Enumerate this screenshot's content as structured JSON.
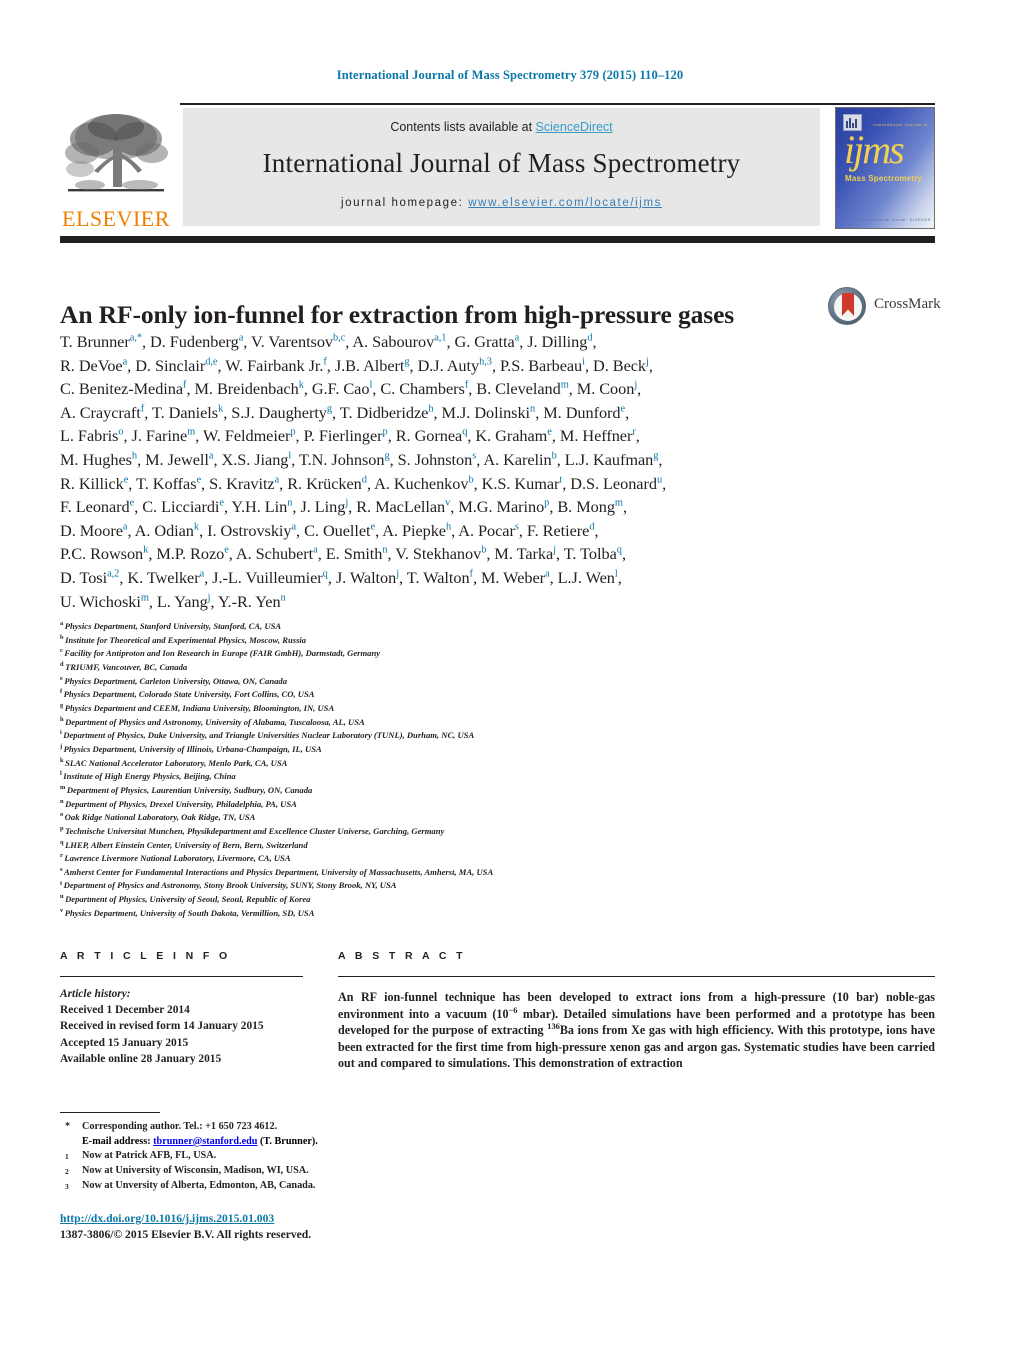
{
  "running_head": "International Journal of Mass Spectrometry 379 (2015) 110–120",
  "masthead": {
    "contents_prefix": "Contents lists available at ",
    "sciencedirect": "ScienceDirect",
    "journal_title": "International Journal of Mass Spectrometry",
    "homepage_prefix": "journal homepage: ",
    "homepage_url": "www.elsevier.com/locate/ijms",
    "publisher_logo_text": "ELSEVIER",
    "cover": {
      "logo_text": "ijms",
      "subtitle": "Mass Spectrometry",
      "top_text": "International Journal of",
      "foot_text": "An International Journal  ·  ELSEVIER"
    },
    "accent_link_color": "#3a9bc8",
    "elsevier_orange": "#ee8000",
    "band_color": "#e7e7e7",
    "rule_color": "#231f20"
  },
  "crossmark": {
    "label": "CrossMark",
    "ribbon_color": "#cf3a2a"
  },
  "title": "An RF-only ion-funnel for extraction from high-pressure gases",
  "authors_lines": [
    [
      {
        "name": "T. Brunner",
        "sup": "a,*"
      },
      {
        "name": ", D. Fudenberg",
        "sup": "a"
      },
      {
        "name": ", V. Varentsov",
        "sup": "b,c"
      },
      {
        "name": ", A. Sabourov",
        "sup": "a,1"
      },
      {
        "name": ", G. Gratta",
        "sup": "a"
      },
      {
        "name": ", J. Dilling",
        "sup": "d"
      },
      {
        "name": ",",
        "sup": ""
      }
    ],
    [
      {
        "name": "R. DeVoe",
        "sup": "a"
      },
      {
        "name": ", D. Sinclair",
        "sup": "d,e"
      },
      {
        "name": ", W. Fairbank Jr.",
        "sup": "f"
      },
      {
        "name": ", J.B. Albert",
        "sup": "g"
      },
      {
        "name": ", D.J. Auty",
        "sup": "h,3"
      },
      {
        "name": ", P.S. Barbeau",
        "sup": "i"
      },
      {
        "name": ", D. Beck",
        "sup": "j"
      },
      {
        "name": ",",
        "sup": ""
      }
    ],
    [
      {
        "name": "C. Benitez-Medina",
        "sup": "f"
      },
      {
        "name": ", M. Breidenbach",
        "sup": "k"
      },
      {
        "name": ", G.F. Cao",
        "sup": "l"
      },
      {
        "name": ", C. Chambers",
        "sup": "f"
      },
      {
        "name": ", B. Cleveland",
        "sup": "m"
      },
      {
        "name": ", M. Coon",
        "sup": "j"
      },
      {
        "name": ",",
        "sup": ""
      }
    ],
    [
      {
        "name": "A. Craycraft",
        "sup": "f"
      },
      {
        "name": ", T. Daniels",
        "sup": "k"
      },
      {
        "name": ", S.J. Daugherty",
        "sup": "g"
      },
      {
        "name": ", T. Didberidze",
        "sup": "h"
      },
      {
        "name": ", M.J. Dolinski",
        "sup": "n"
      },
      {
        "name": ", M. Dunford",
        "sup": "e"
      },
      {
        "name": ",",
        "sup": ""
      }
    ],
    [
      {
        "name": "L. Fabris",
        "sup": "o"
      },
      {
        "name": ", J. Farine",
        "sup": "m"
      },
      {
        "name": ", W. Feldmeier",
        "sup": "p"
      },
      {
        "name": ", P. Fierlinger",
        "sup": "p"
      },
      {
        "name": ", R. Gornea",
        "sup": "q"
      },
      {
        "name": ", K. Graham",
        "sup": "e"
      },
      {
        "name": ", M. Heffner",
        "sup": "r"
      },
      {
        "name": ",",
        "sup": ""
      }
    ],
    [
      {
        "name": "M. Hughes",
        "sup": "h"
      },
      {
        "name": ", M. Jewell",
        "sup": "a"
      },
      {
        "name": ", X.S. Jiang",
        "sup": "l"
      },
      {
        "name": ", T.N. Johnson",
        "sup": "g"
      },
      {
        "name": ", S. Johnston",
        "sup": "s"
      },
      {
        "name": ", A. Karelin",
        "sup": "b"
      },
      {
        "name": ", L.J. Kaufman",
        "sup": "g"
      },
      {
        "name": ",",
        "sup": ""
      }
    ],
    [
      {
        "name": "R. Killick",
        "sup": "e"
      },
      {
        "name": ", T. Koffas",
        "sup": "e"
      },
      {
        "name": ", S. Kravitz",
        "sup": "a"
      },
      {
        "name": ", R. Krücken",
        "sup": "d"
      },
      {
        "name": ", A. Kuchenkov",
        "sup": "b"
      },
      {
        "name": ", K.S. Kumar",
        "sup": "t"
      },
      {
        "name": ", D.S. Leonard",
        "sup": "u"
      },
      {
        "name": ",",
        "sup": ""
      }
    ],
    [
      {
        "name": "F. Leonard",
        "sup": "e"
      },
      {
        "name": ", C. Licciardi",
        "sup": "e"
      },
      {
        "name": ", Y.H. Lin",
        "sup": "n"
      },
      {
        "name": ", J. Ling",
        "sup": "j"
      },
      {
        "name": ", R. MacLellan",
        "sup": "v"
      },
      {
        "name": ", M.G. Marino",
        "sup": "p"
      },
      {
        "name": ", B. Mong",
        "sup": "m"
      },
      {
        "name": ",",
        "sup": ""
      }
    ],
    [
      {
        "name": "D. Moore",
        "sup": "a"
      },
      {
        "name": ", A. Odian",
        "sup": "k"
      },
      {
        "name": ", I. Ostrovskiy",
        "sup": "a"
      },
      {
        "name": ", C. Ouellet",
        "sup": "e"
      },
      {
        "name": ", A. Piepke",
        "sup": "h"
      },
      {
        "name": ", A. Pocar",
        "sup": "s"
      },
      {
        "name": ", F. Retiere",
        "sup": "d"
      },
      {
        "name": ",",
        "sup": ""
      }
    ],
    [
      {
        "name": "P.C. Rowson",
        "sup": "k"
      },
      {
        "name": ", M.P. Rozo",
        "sup": "e"
      },
      {
        "name": ", A. Schubert",
        "sup": "a"
      },
      {
        "name": ", E. Smith",
        "sup": "n"
      },
      {
        "name": ", V. Stekhanov",
        "sup": "b"
      },
      {
        "name": ", M. Tarka",
        "sup": "j"
      },
      {
        "name": ", T. Tolba",
        "sup": "q"
      },
      {
        "name": ",",
        "sup": ""
      }
    ],
    [
      {
        "name": "D. Tosi",
        "sup": "a,2"
      },
      {
        "name": ", K. Twelker",
        "sup": "a"
      },
      {
        "name": ", J.-L. Vuilleumier",
        "sup": "q"
      },
      {
        "name": ", J. Walton",
        "sup": "j"
      },
      {
        "name": ", T. Walton",
        "sup": "f"
      },
      {
        "name": ", M. Weber",
        "sup": "a"
      },
      {
        "name": ", L.J. Wen",
        "sup": "l"
      },
      {
        "name": ",",
        "sup": ""
      }
    ],
    [
      {
        "name": "U. Wichoski",
        "sup": "m"
      },
      {
        "name": ", L. Yang",
        "sup": "j"
      },
      {
        "name": ", Y.-R. Yen",
        "sup": "n"
      },
      {
        "name": "",
        "sup": ""
      }
    ]
  ],
  "affiliations": [
    {
      "key": "a",
      "text": "Physics Department, Stanford University, Stanford, CA, USA"
    },
    {
      "key": "b",
      "text": "Institute for Theoretical and Experimental Physics, Moscow, Russia"
    },
    {
      "key": "c",
      "text": "Facility for Antiproton and Ion Research in Europe (FAIR GmbH), Darmstadt, Germany"
    },
    {
      "key": "d",
      "text": "TRIUMF, Vancouver, BC, Canada"
    },
    {
      "key": "e",
      "text": "Physics Department, Carleton University, Ottawa, ON, Canada"
    },
    {
      "key": "f",
      "text": "Physics Department, Colorado State University, Fort Collins, CO, USA"
    },
    {
      "key": "g",
      "text": "Physics Department and CEEM, Indiana University, Bloomington, IN, USA"
    },
    {
      "key": "h",
      "text": "Department of Physics and Astronomy, University of Alabama, Tuscaloosa, AL, USA"
    },
    {
      "key": "i",
      "text": "Department of Physics, Duke University, and Triangle Universities Nuclear Laboratory (TUNL), Durham, NC, USA"
    },
    {
      "key": "j",
      "text": "Physics Department, University of Illinois, Urbana-Champaign, IL, USA"
    },
    {
      "key": "k",
      "text": "SLAC National Accelerator Laboratory, Menlo Park, CA, USA"
    },
    {
      "key": "l",
      "text": "Institute of High Energy Physics, Beijing, China"
    },
    {
      "key": "m",
      "text": "Department of Physics, Laurentian University, Sudbury, ON, Canada"
    },
    {
      "key": "n",
      "text": "Department of Physics, Drexel University, Philadelphia, PA, USA"
    },
    {
      "key": "o",
      "text": "Oak Ridge National Laboratory, Oak Ridge, TN, USA"
    },
    {
      "key": "p",
      "text": "Technische Universitat Munchen, Physikdepartment and Excellence Cluster Universe, Garching, Germany"
    },
    {
      "key": "q",
      "text": "LHEP, Albert Einstein Center, University of Bern, Bern, Switzerland"
    },
    {
      "key": "r",
      "text": "Lawrence Livermore National Laboratory, Livermore, CA, USA"
    },
    {
      "key": "s",
      "text": "Amherst Center for Fundamental Interactions and Physics Department, University of Massachusetts, Amherst, MA, USA"
    },
    {
      "key": "t",
      "text": "Department of Physics and Astronomy, Stony Brook University, SUNY, Stony Brook, NY, USA"
    },
    {
      "key": "u",
      "text": "Department of Physics, University of Seoul, Seoul, Republic of Korea"
    },
    {
      "key": "v",
      "text": "Physics Department, University of South Dakota, Vermillion, SD, USA"
    }
  ],
  "article_info": {
    "heading": "A R T I C L E    I N F O",
    "history_label": "Article history:",
    "history": [
      "Received 1 December 2014",
      "Received in revised form 14 January 2015",
      "Accepted 15 January 2015",
      "Available online 28 January 2015"
    ]
  },
  "abstract": {
    "heading": "A B S T R A C T",
    "part1": "An RF ion-funnel technique has been developed to extract ions from a high-pressure (10 bar) noble-gas environment into a vacuum (10",
    "exp1": "−6",
    "part2": " mbar). Detailed simulations have been performed and a prototype has been developed for the purpose of extracting ",
    "exp2": "136",
    "part3": "Ba ions from Xe gas with high efficiency. With this prototype, ions have been extracted for the first time from high-pressure xenon gas and argon gas. Systematic studies have been carried out and compared to simulations. This demonstration of extraction"
  },
  "footnotes": {
    "corresponding": {
      "marker": "*",
      "line1": "Corresponding author. Tel.: +1 650 723 4612.",
      "email_label": "E-mail address:",
      "email": "tbrunner@stanford.edu",
      "email_suffix": " (T. Brunner)."
    },
    "numbered": [
      {
        "marker": "1",
        "text": "Now at Patrick AFB, FL, USA."
      },
      {
        "marker": "2",
        "text": "Now at University of Wisconsin, Madison, WI, USA."
      },
      {
        "marker": "3",
        "text": "Now at Unversity of Alberta, Edmonton, AB, Canada."
      }
    ]
  },
  "doi": "http://dx.doi.org/10.1016/j.ijms.2015.01.003",
  "copyright": "1387-3806/© 2015 Elsevier B.V. All rights reserved."
}
